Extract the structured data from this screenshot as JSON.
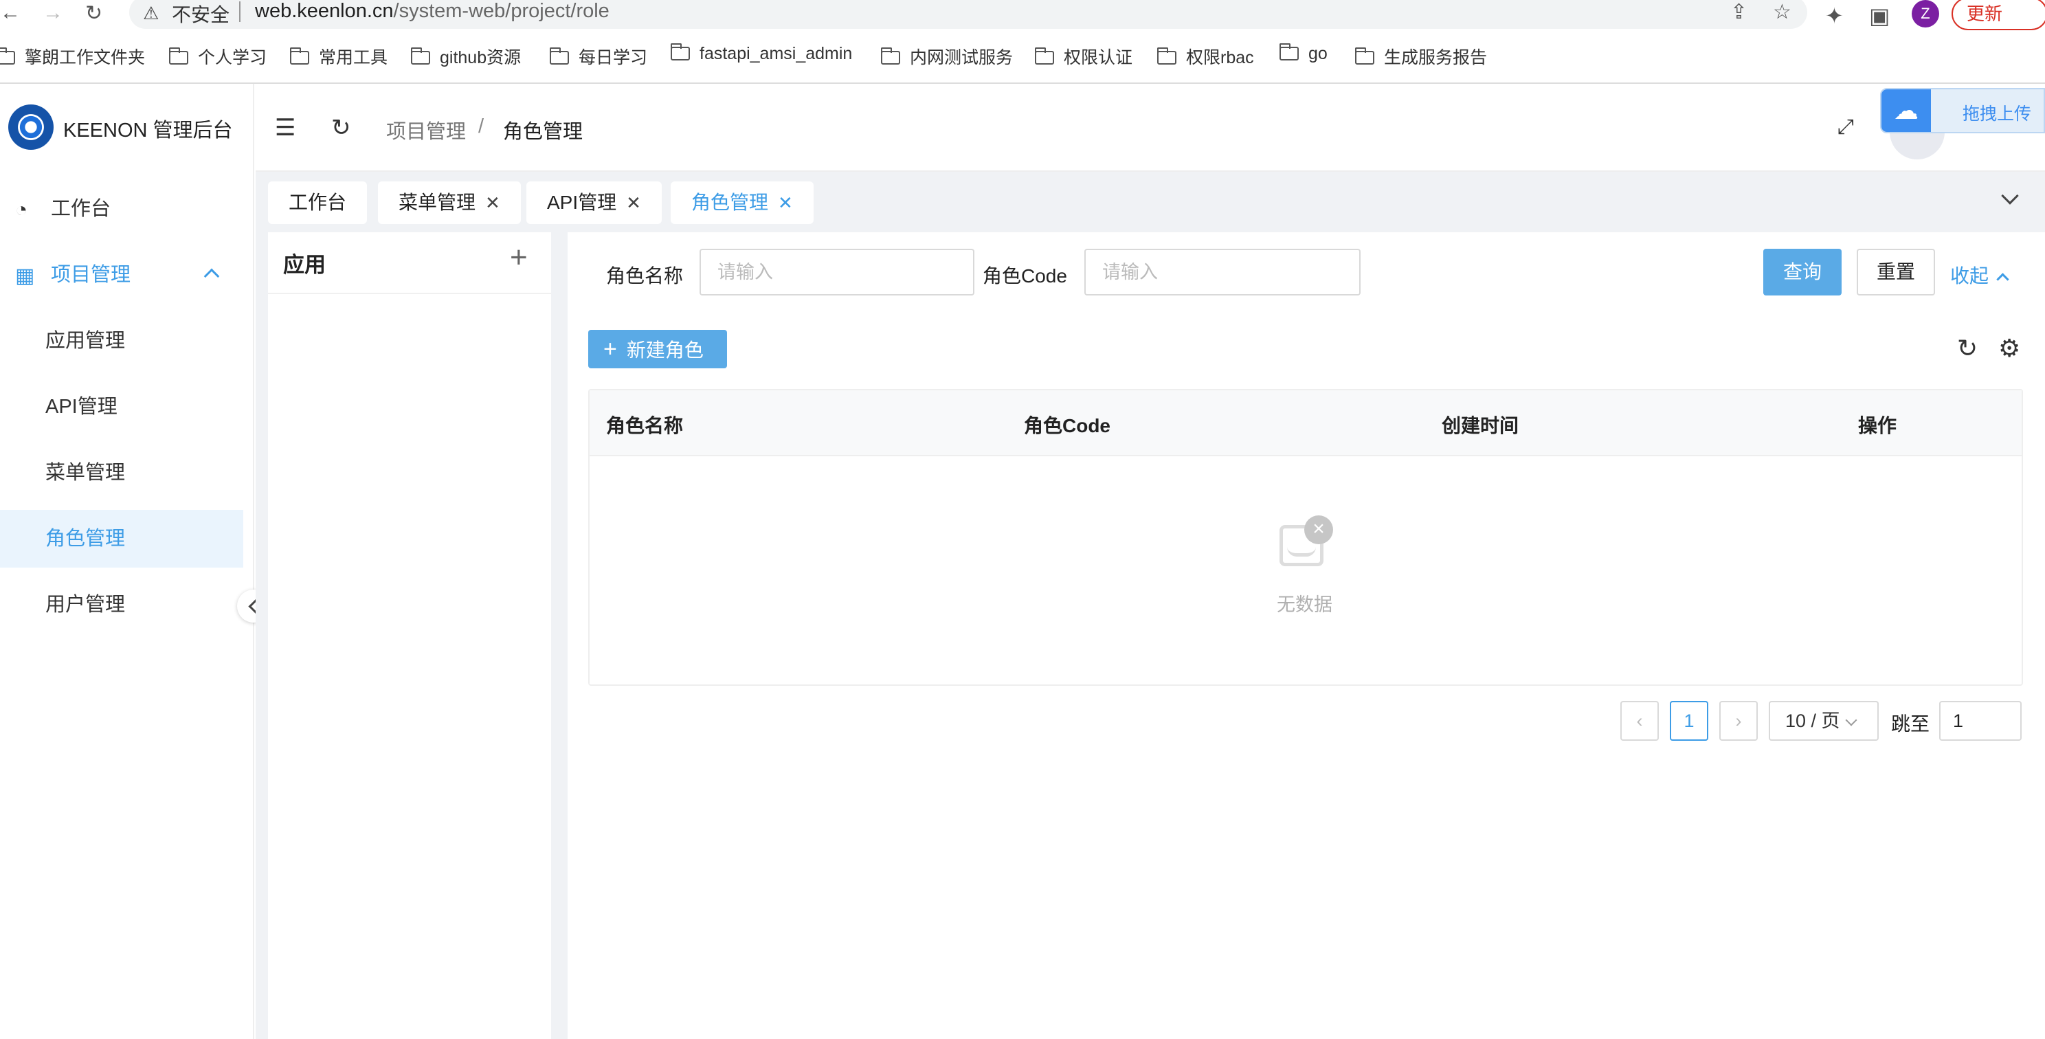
{
  "browser": {
    "insecure_label": "不安全",
    "url_host": "web.keenlon.cn",
    "url_path": "/system-web/project/role",
    "profile_initial": "Z",
    "update_label": "更新"
  },
  "bookmarks": [
    "擎朗工作文件夹",
    "个人学习",
    "常用工具",
    "github资源",
    "每日学习",
    "fastapi_amsi_admin",
    "内网测试服务",
    "权限认证",
    "权限rbac",
    "go",
    "生成服务报告"
  ],
  "sidebar": {
    "app_title": "KEENON 管理后台",
    "dashboard_label": "工作台",
    "project_group_label": "项目管理",
    "items": [
      "应用管理",
      "API管理",
      "菜单管理",
      "角色管理",
      "用户管理"
    ]
  },
  "header": {
    "breadcrumb_parent": "项目管理",
    "breadcrumb_sep": "/",
    "breadcrumb_current": "角色管理",
    "upload_label": "拖拽上传"
  },
  "tabs": [
    {
      "label": "工作台",
      "closable": false
    },
    {
      "label": "菜单管理",
      "closable": true
    },
    {
      "label": "API管理",
      "closable": true
    },
    {
      "label": "角色管理",
      "closable": true,
      "active": true
    }
  ],
  "app_panel": {
    "title": "应用",
    "add_symbol": "+"
  },
  "filters": {
    "role_name_label": "角色名称",
    "role_name_placeholder": "请输入",
    "role_code_label": "角色Code",
    "role_code_placeholder": "请输入",
    "query_label": "查询",
    "reset_label": "重置",
    "collapse_label": "收起"
  },
  "toolbar": {
    "new_role_label": "新建角色"
  },
  "table": {
    "columns": [
      "角色名称",
      "角色Code",
      "创建时间",
      "操作"
    ],
    "empty_text": "无数据"
  },
  "pagination": {
    "current_page": "1",
    "page_size": "10 / 页",
    "jump_label": "跳至",
    "jump_value": "1"
  },
  "colors": {
    "accent": "#3d9ce6",
    "button_primary": "#5aaae6"
  }
}
